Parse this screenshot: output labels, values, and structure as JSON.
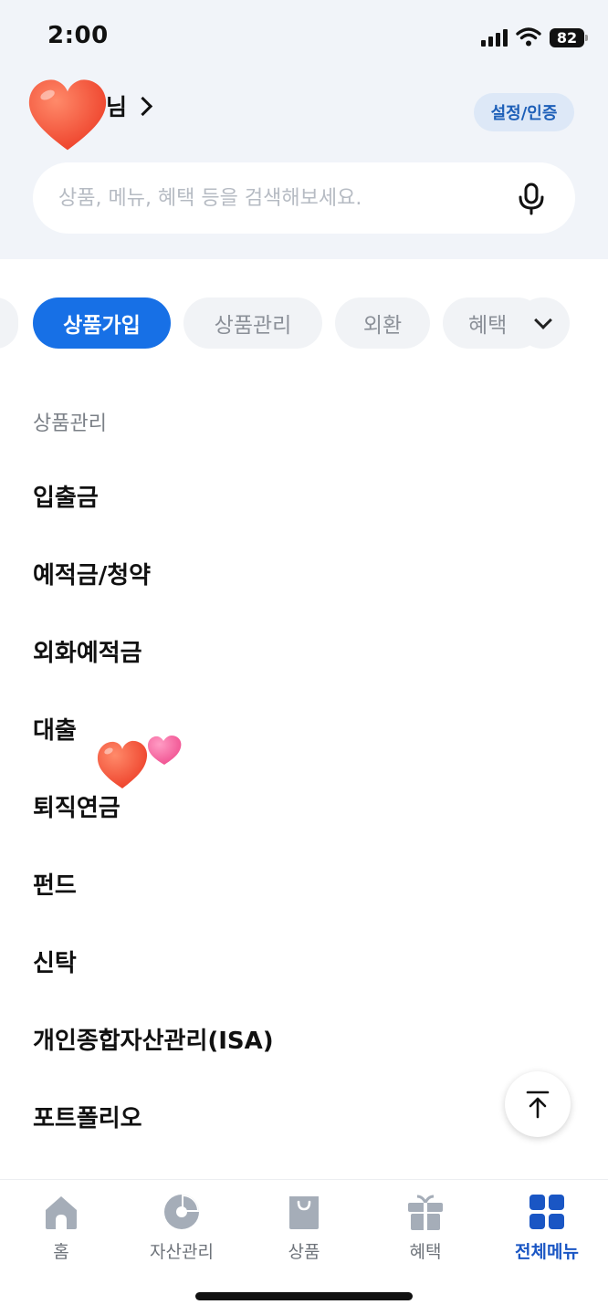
{
  "status_bar": {
    "time": "2:00",
    "battery": "82"
  },
  "header": {
    "greeting_suffix": "님",
    "settings_label": "설정/인증"
  },
  "search": {
    "placeholder": "상품, 메뉴, 혜택 등을 검색해보세요."
  },
  "tabs": [
    {
      "label": "상품가입",
      "active": true
    },
    {
      "label": "상품관리",
      "active": false
    },
    {
      "label": "외환",
      "active": false
    },
    {
      "label": "혜택",
      "active": false
    }
  ],
  "section": {
    "title": "상품관리",
    "items": [
      "입출금",
      "예적금/청약",
      "외화예적금",
      "대출",
      "퇴직연금",
      "펀드",
      "신탁",
      "개인종합자산관리(ISA)",
      "포트폴리오"
    ]
  },
  "bottom_nav": [
    {
      "label": "홈",
      "icon": "home-icon",
      "active": false
    },
    {
      "label": "자산관리",
      "icon": "pie-chart-icon",
      "active": false
    },
    {
      "label": "상품",
      "icon": "shopping-bag-icon",
      "active": false
    },
    {
      "label": "혜택",
      "icon": "gift-icon",
      "active": false
    },
    {
      "label": "전체메뉴",
      "icon": "grid-menu-icon",
      "active": true
    }
  ],
  "colors": {
    "accent": "#1770e6",
    "active_nav": "#1a56c4",
    "header_bg": "#f1f4f9",
    "heart": "#f2503a",
    "pink_heart": "#f35c9a"
  }
}
